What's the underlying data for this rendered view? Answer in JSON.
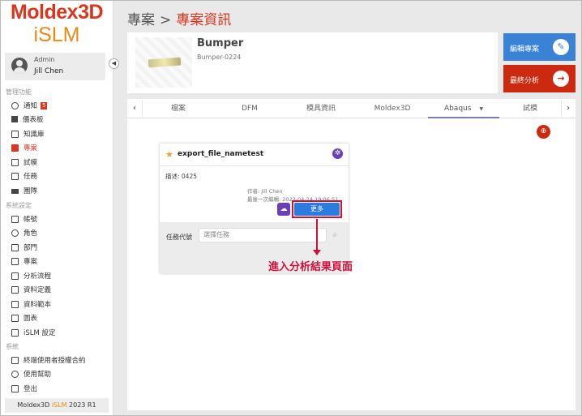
{
  "app": {
    "logo_line1": "Moldex3D",
    "logo_line2": "iSLM",
    "version_prefix": "Moldex3D ",
    "version_accent": "iSLM",
    "version_suffix": " 2023 R1"
  },
  "user": {
    "role": "Admin",
    "name": "Jill Chen"
  },
  "sidebar": {
    "sections": [
      {
        "title": "管理功能",
        "items": [
          {
            "label": "通知",
            "icon": "bell-icon",
            "badge": "5"
          },
          {
            "label": "儀表板",
            "icon": "dashboard-icon"
          },
          {
            "label": "知識庫",
            "icon": "book-icon"
          },
          {
            "label": "專案",
            "icon": "folder-icon",
            "active": true
          },
          {
            "label": "試模",
            "icon": "trial-icon"
          },
          {
            "label": "任務",
            "icon": "task-icon"
          },
          {
            "label": "團隊",
            "icon": "team-icon"
          }
        ]
      },
      {
        "title": "系統設定",
        "items": [
          {
            "label": "帳號",
            "icon": "account-icon"
          },
          {
            "label": "角色",
            "icon": "role-icon"
          },
          {
            "label": "部門",
            "icon": "department-icon"
          },
          {
            "label": "專案",
            "icon": "project-setting-icon"
          },
          {
            "label": "分析流程",
            "icon": "flow-icon"
          },
          {
            "label": "資料定義",
            "icon": "data-def-icon"
          },
          {
            "label": "資料範本",
            "icon": "template-icon"
          },
          {
            "label": "圖表",
            "icon": "chart-icon"
          },
          {
            "label": "iSLM 設定",
            "icon": "settings-icon"
          }
        ]
      },
      {
        "title": "系統",
        "items": [
          {
            "label": "終端使用者授權合約",
            "icon": "license-icon"
          },
          {
            "label": "使用幫助",
            "icon": "help-icon"
          },
          {
            "label": "登出",
            "icon": "logout-icon"
          }
        ]
      }
    ]
  },
  "breadcrumb": {
    "parent": "專案",
    "separator": ">",
    "current": "專案資訊"
  },
  "project": {
    "name": "Bumper",
    "code": "Bumper-0224"
  },
  "actions": {
    "edit": "編輯專案",
    "final": "最終分析"
  },
  "tabs": [
    {
      "label": "檔案"
    },
    {
      "label": "DFM"
    },
    {
      "label": "模具資訊"
    },
    {
      "label": "Moldex3D"
    },
    {
      "label": "Abaqus",
      "active": true
    },
    {
      "label": "試模"
    }
  ],
  "task": {
    "title": "export_file_nametest",
    "description": "描述: 0425",
    "author": "作者: Jill Chen",
    "last_edit": "最後一次編輯: 2023-04-24 19:06:51",
    "more_label": "更多",
    "task_code_label": "任務代號",
    "task_select_placeholder": "選擇任務"
  },
  "annotation": {
    "text": "進入分析結果頁面",
    "color": "#d0103a"
  },
  "colors": {
    "brand": "#d9361d",
    "accent": "#e88a12",
    "edit": "#3a82d6",
    "final": "#cc2a10",
    "purple": "#6a40b8",
    "more": "#2c7be0"
  }
}
